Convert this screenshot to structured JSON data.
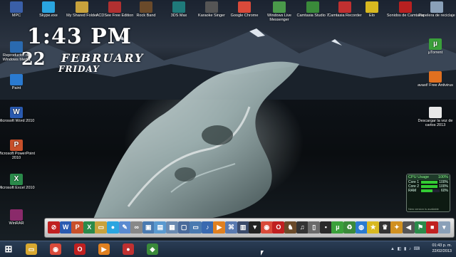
{
  "wallpaper": {
    "description_colors": {
      "sky": "#1b2330",
      "ice": "#cfdede",
      "sun": "#fff0c8"
    }
  },
  "clock_gadget": {
    "time": "1:43 PM",
    "day_number": "22",
    "month": "FEBRUARY",
    "weekday": "FRIDAY"
  },
  "desktop_icons_top": [
    {
      "label": "MPC",
      "icon": "app-icon",
      "color": "#3a5fa8"
    },
    {
      "label": "Skype.exe",
      "icon": "skype-icon",
      "color": "#2aa5e0"
    },
    {
      "label": "My Shared Folder",
      "icon": "folder-icon",
      "color": "#c8a23c"
    },
    {
      "label": "ACDSee Free Edition",
      "icon": "acdsee-icon",
      "color": "#b03030"
    },
    {
      "label": "Rock Band",
      "icon": "game-icon",
      "color": "#6a4a2a"
    },
    {
      "label": "3DS Max",
      "icon": "3ds-icon",
      "color": "#1f7a7a"
    },
    {
      "label": "Karaoke Singer",
      "icon": "mic-icon",
      "color": "#555555"
    },
    {
      "label": "Google Chrome",
      "icon": "chrome-icon",
      "color": "#d94a3a"
    },
    {
      "label": "Windows Live Messenger",
      "icon": "messenger-icon",
      "color": "#4a9a4a"
    },
    {
      "label": "Camtasia Studio 7",
      "icon": "camtasia-icon",
      "color": "#3a8a3a"
    },
    {
      "label": "Camtasia Recorder",
      "icon": "recorder-icon",
      "color": "#c03030"
    },
    {
      "label": "Elo",
      "icon": "star-icon",
      "color": "#d8b820"
    },
    {
      "label": "Sonidos de Camtasia",
      "icon": "sound-icon",
      "color": "#b82020"
    },
    {
      "label": "Papelera de reciclaje",
      "icon": "recycle-bin-icon",
      "color": "#8aa0b8"
    }
  ],
  "desktop_icons_left": [
    {
      "label": "Reproductor de Windows Media",
      "icon": "media-player-icon",
      "color": "#2a6ab0"
    },
    {
      "label": "Paint",
      "icon": "paint-icon",
      "color": "#2a7ad0"
    },
    {
      "label": "Microsoft Word 2010",
      "icon": "word-icon",
      "color": "#2a5ab0",
      "glyph": "W"
    },
    {
      "label": "Microsoft PowerPoint 2010",
      "icon": "powerpoint-icon",
      "color": "#c8502a",
      "glyph": "P"
    },
    {
      "label": "Microsoft Excel 2010",
      "icon": "excel-icon",
      "color": "#2a8a4a",
      "glyph": "X"
    },
    {
      "label": "WinRAR",
      "icon": "winrar-icon",
      "color": "#8a2a6a"
    }
  ],
  "desktop_icons_right": [
    {
      "label": "µTorrent",
      "icon": "utorrent-icon",
      "color": "#3aa03a",
      "glyph": "µ"
    },
    {
      "label": "avast! Free Antivirus",
      "icon": "avast-icon",
      "color": "#e07020"
    },
    {
      "label": "Descargar la voz de carlos 2013",
      "icon": "document-icon",
      "color": "#e8e8e8"
    }
  ],
  "cpu_gadget": {
    "title": "CPU Usage",
    "percent": "100%",
    "rows": [
      {
        "label": "Core 1",
        "value": "100%",
        "fill": 1.0
      },
      {
        "label": "Core 2",
        "value": "100%",
        "fill": 1.0
      },
      {
        "label": "RAM",
        "value": "60%",
        "fill": 0.6
      }
    ],
    "footer": "New version is available"
  },
  "dock_icons": [
    {
      "name": "no-entry-icon",
      "color": "#c02020",
      "glyph": "⊘"
    },
    {
      "name": "word-icon",
      "color": "#2a5ab0",
      "glyph": "W"
    },
    {
      "name": "powerpoint-icon",
      "color": "#c8502a",
      "glyph": "P"
    },
    {
      "name": "excel-icon",
      "color": "#2a8a4a",
      "glyph": "X"
    },
    {
      "name": "folder-icon",
      "color": "#c8a23c",
      "glyph": "▭"
    },
    {
      "name": "chat-icon",
      "color": "#2aa5e0",
      "glyph": "●"
    },
    {
      "name": "paint-icon",
      "color": "#5a8ad0",
      "glyph": "✎"
    },
    {
      "name": "link-icon",
      "color": "#888888",
      "glyph": "∞"
    },
    {
      "name": "window-icon",
      "color": "#4a7ab0",
      "glyph": "▣"
    },
    {
      "name": "pictures-icon",
      "color": "#5a9ad0",
      "glyph": "▤"
    },
    {
      "name": "documents-icon",
      "color": "#6a8ab0",
      "glyph": "▦"
    },
    {
      "name": "monitor-icon",
      "color": "#4a6a9a",
      "glyph": "▢"
    },
    {
      "name": "folder2-icon",
      "color": "#4a7ab0",
      "glyph": "▭"
    },
    {
      "name": "music-icon",
      "color": "#3a6ab0",
      "glyph": "♪"
    },
    {
      "name": "media-player-icon",
      "color": "#e08020",
      "glyph": "▶"
    },
    {
      "name": "network-icon",
      "color": "#5a7ab0",
      "glyph": "⌘"
    },
    {
      "name": "film-icon",
      "color": "#3a4a6a",
      "glyph": "▥"
    },
    {
      "name": "shirt-icon",
      "color": "#222222",
      "glyph": "▼"
    },
    {
      "name": "chrome-icon",
      "color": "#d94a3a",
      "glyph": "◉"
    },
    {
      "name": "opera-icon",
      "color": "#c02020",
      "glyph": "O"
    },
    {
      "name": "game-icon",
      "color": "#6a4a2a",
      "glyph": "♞"
    },
    {
      "name": "audio-icon",
      "color": "#333333",
      "glyph": "♫"
    },
    {
      "name": "usb-icon",
      "color": "#6a6a6a",
      "glyph": "▯"
    },
    {
      "name": "terminal-icon",
      "color": "#2a2a2a",
      "glyph": "▪"
    },
    {
      "name": "utorrent-icon",
      "color": "#3aa03a",
      "glyph": "µ"
    },
    {
      "name": "recycle-icon",
      "color": "#3a8a3a",
      "glyph": "♻"
    },
    {
      "name": "globe-icon",
      "color": "#2a7ad0",
      "glyph": "◍"
    },
    {
      "name": "star-icon",
      "color": "#d8b820",
      "glyph": "★"
    },
    {
      "name": "trophy-icon",
      "color": "#333333",
      "glyph": "♛"
    },
    {
      "name": "tools-icon",
      "color": "#d09020",
      "glyph": "✦"
    },
    {
      "name": "sound-icon",
      "color": "#555555",
      "glyph": "◀"
    },
    {
      "name": "flag-icon",
      "color": "#2a8a4a",
      "glyph": "⚑"
    },
    {
      "name": "red-app-icon",
      "color": "#c02020",
      "glyph": "■"
    },
    {
      "name": "recycle-bin-icon",
      "color": "#8aa0b8",
      "glyph": "▾"
    }
  ],
  "taskbar": {
    "items": [
      {
        "name": "windows-explorer-icon",
        "color": "#d8a830",
        "glyph": "▭"
      },
      {
        "name": "chrome-icon",
        "color": "#d94a3a",
        "glyph": "◉"
      },
      {
        "name": "opera-icon",
        "color": "#c02020",
        "glyph": "O"
      },
      {
        "name": "media-player-icon",
        "color": "#e08020",
        "glyph": "▶"
      },
      {
        "name": "camtasia-recorder-icon",
        "color": "#c03030",
        "glyph": "●"
      },
      {
        "name": "camtasia-icon",
        "color": "#3a8a3a",
        "glyph": "◆"
      }
    ],
    "tray_time": "01:43 p. m.",
    "tray_date": "22/02/2013"
  }
}
